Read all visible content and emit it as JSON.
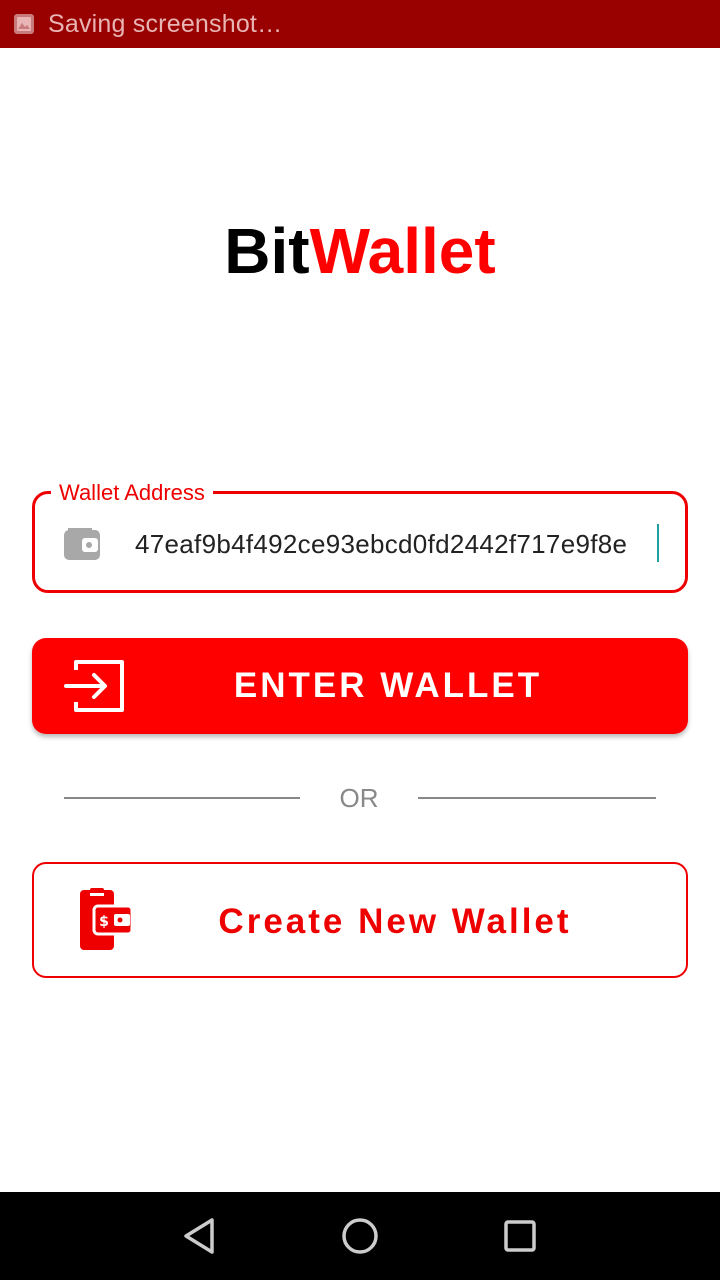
{
  "status_bar": {
    "text": "Saving screenshot…",
    "icon": "image-icon"
  },
  "logo": {
    "part1": "Bit",
    "part2": "Wallet"
  },
  "wallet_address": {
    "label": "Wallet Address",
    "value": "47eaf9b4f492ce93ebcd0fd2442f717e9f8e",
    "icon": "wallet-icon"
  },
  "enter_button": {
    "label": "ENTER WALLET",
    "icon": "login-icon"
  },
  "divider": {
    "text": "OR"
  },
  "create_button": {
    "label": "Create New Wallet",
    "icon": "mobile-wallet-icon"
  },
  "nav": {
    "back_icon": "back-triangle-icon",
    "home_icon": "home-circle-icon",
    "recents_icon": "recents-square-icon"
  },
  "colors": {
    "accent": "#ff0000",
    "status_bar": "#990000",
    "text_dark": "#000000",
    "muted": "#888888"
  }
}
